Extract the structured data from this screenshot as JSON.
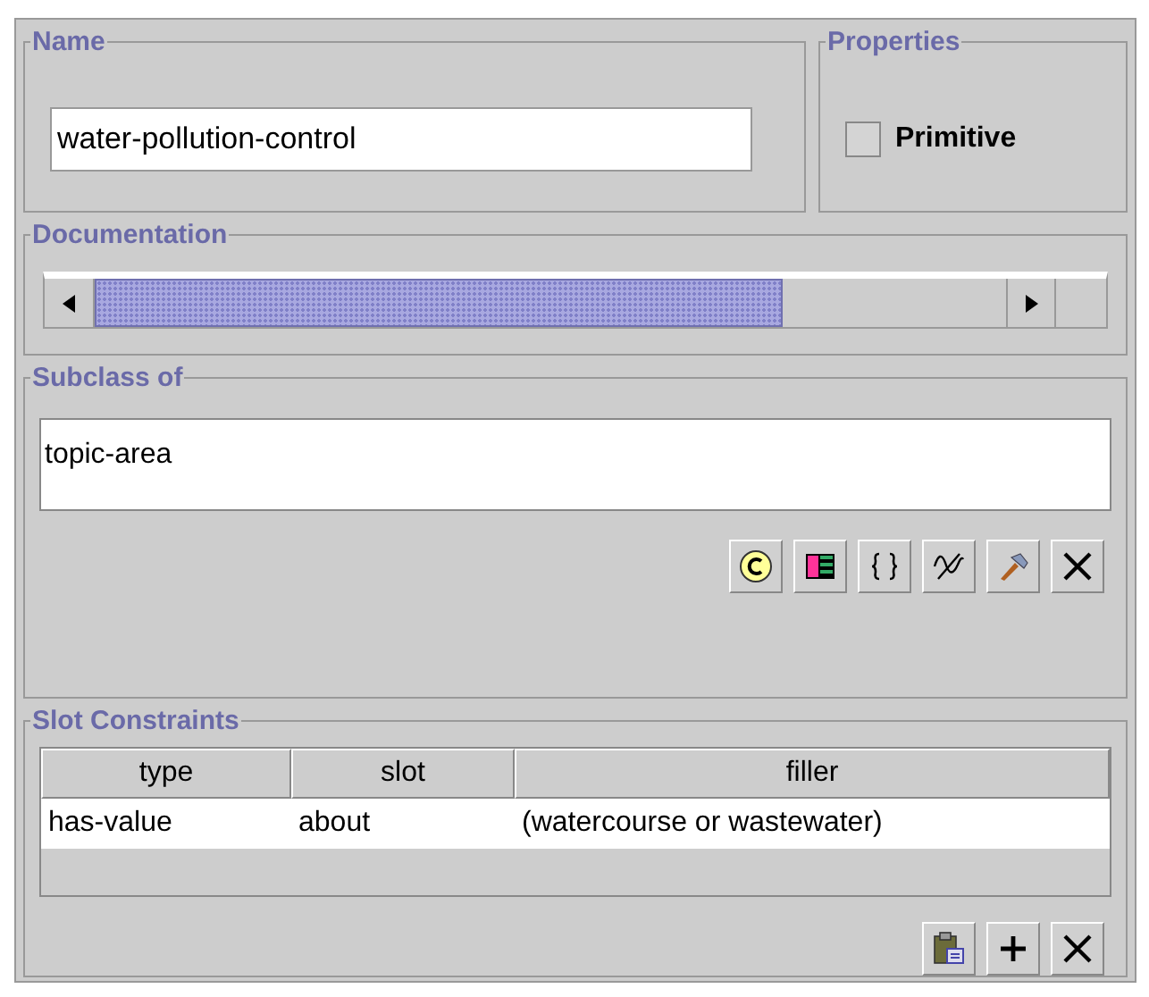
{
  "name": {
    "title": "Name",
    "value": "water-pollution-control"
  },
  "properties": {
    "title": "Properties",
    "primitive": {
      "label": "Primitive",
      "checked": false
    }
  },
  "documentation": {
    "title": "Documentation"
  },
  "subclass_of": {
    "title": "Subclass of",
    "items": [
      "topic-area"
    ],
    "buttons": [
      {
        "kind": "class"
      },
      {
        "kind": "list"
      },
      {
        "kind": "braces"
      },
      {
        "kind": "wave"
      },
      {
        "kind": "hammer"
      },
      {
        "kind": "delete"
      }
    ]
  },
  "slot_constraints": {
    "title": "Slot Constraints",
    "columns": [
      "type",
      "slot",
      "filler"
    ],
    "rows": [
      [
        "has-value",
        "about",
        "(watercourse or wastewater)"
      ]
    ],
    "buttons": [
      {
        "kind": "paste"
      },
      {
        "kind": "add"
      },
      {
        "kind": "delete"
      }
    ]
  }
}
